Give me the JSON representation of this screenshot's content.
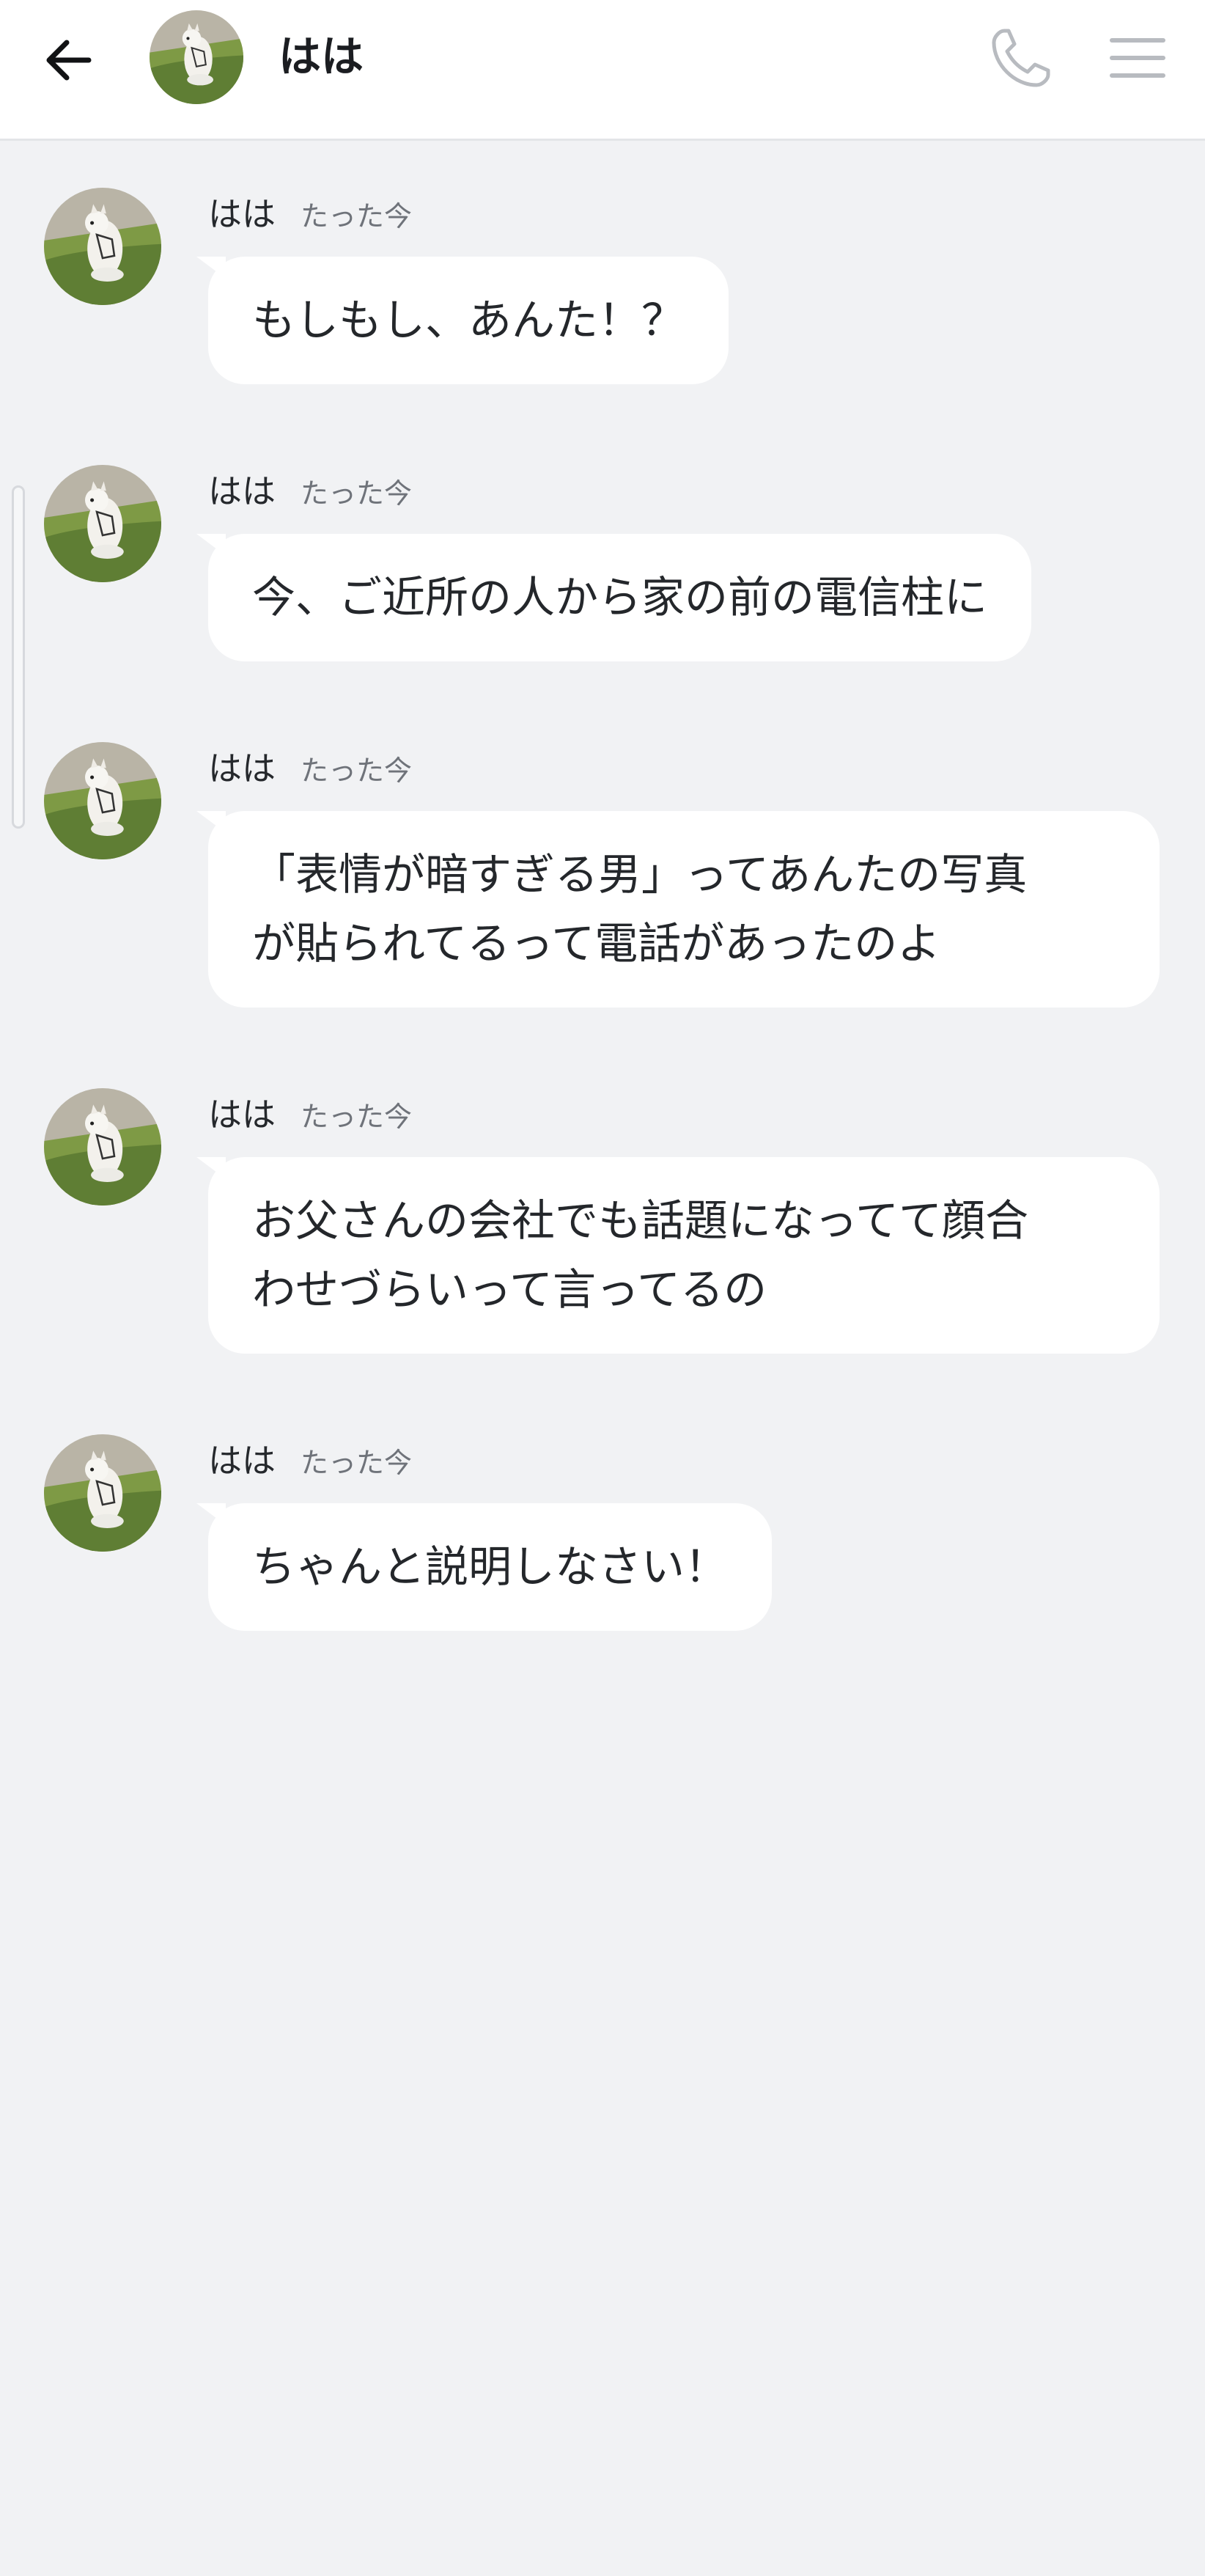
{
  "header": {
    "back_icon": "arrow-left-icon",
    "title": "はは",
    "call_icon": "phone-icon",
    "menu_icon": "hamburger-menu-icon"
  },
  "messages": [
    {
      "sender": "はは",
      "time": "たった今",
      "text": "もしもし、あんた！？"
    },
    {
      "sender": "はは",
      "time": "たった今",
      "text": "今、ご近所の人から家の前の電信柱に"
    },
    {
      "sender": "はは",
      "time": "たった今",
      "text_lines": [
        "「表情が暗すぎる男」ってあんたの写真",
        "が貼られてるって電話があったのよ"
      ]
    },
    {
      "sender": "はは",
      "time": "たった今",
      "text_lines": [
        "お父さんの会社でも話題になってて顔合",
        "わせづらいって言ってるの"
      ]
    },
    {
      "sender": "はは",
      "time": "たった今",
      "text": "ちゃんと説明しなさい！"
    }
  ],
  "colors": {
    "background": "#f1f2f4",
    "bubble": "#ffffff",
    "header_icon_gray": "#b8bbc0"
  }
}
